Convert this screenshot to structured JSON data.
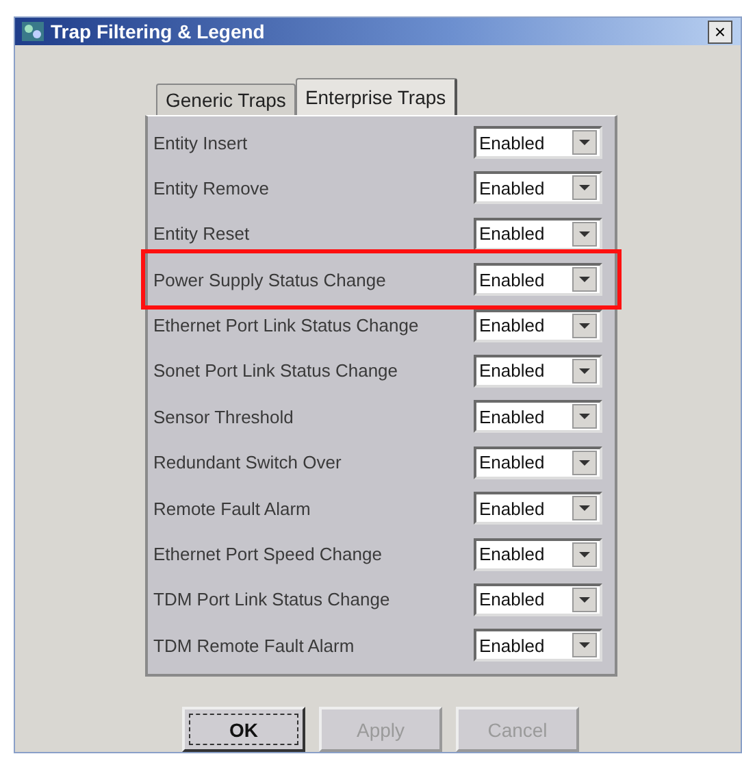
{
  "window": {
    "title": "Trap Filtering & Legend",
    "close": "×"
  },
  "tabs": [
    {
      "label": "Generic Traps",
      "selected": false
    },
    {
      "label": "Enterprise Traps",
      "selected": true
    }
  ],
  "rows": [
    {
      "name": "Entity Insert",
      "value": "Enabled",
      "highlighted": false
    },
    {
      "name": "Entity Remove",
      "value": "Enabled",
      "highlighted": false
    },
    {
      "name": "Entity Reset",
      "value": "Enabled",
      "highlighted": false
    },
    {
      "name": "Power Supply Status Change",
      "value": "Enabled",
      "highlighted": true
    },
    {
      "name": "Ethernet Port Link Status Change",
      "value": "Enabled",
      "highlighted": false
    },
    {
      "name": "Sonet Port Link Status Change",
      "value": "Enabled",
      "highlighted": false
    },
    {
      "name": "Sensor Threshold",
      "value": "Enabled",
      "highlighted": false
    },
    {
      "name": "Redundant Switch Over",
      "value": "Enabled",
      "highlighted": false
    },
    {
      "name": "Remote Fault Alarm",
      "value": "Enabled",
      "highlighted": false
    },
    {
      "name": "Ethernet Port Speed Change",
      "value": "Enabled",
      "highlighted": false
    },
    {
      "name": "TDM Port Link Status Change",
      "value": "Enabled",
      "highlighted": false
    },
    {
      "name": "TDM Remote Fault Alarm",
      "value": "Enabled",
      "highlighted": false
    }
  ],
  "buttons": [
    {
      "label": "OK",
      "disabled": false,
      "focused": true
    },
    {
      "label": "Apply",
      "disabled": true,
      "focused": false
    },
    {
      "label": "Cancel",
      "disabled": true,
      "focused": false
    }
  ]
}
